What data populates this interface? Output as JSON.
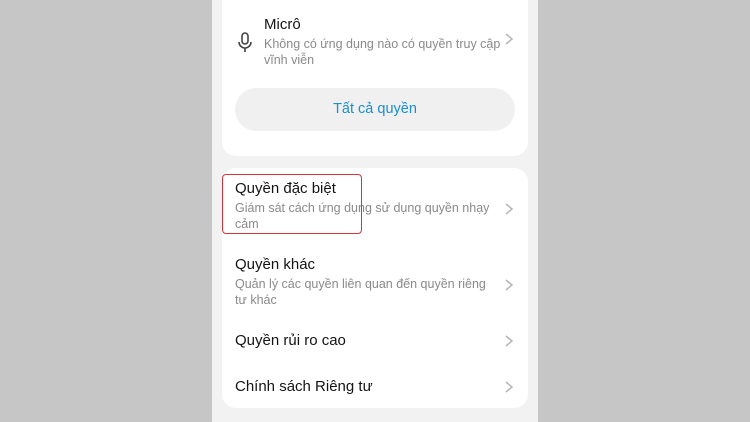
{
  "permissions": {
    "mic": {
      "title": "Micrô",
      "desc": "Không có ứng dụng nào có quyền truy cập vĩnh viễn",
      "icon": "microphone-icon"
    },
    "all_button": "Tất cả quyền",
    "items": [
      {
        "title": "Quyền đặc biệt",
        "desc": "Giám sát cách ứng dụng sử dụng quyền nhạy cảm"
      },
      {
        "title": "Quyền khác",
        "desc": "Quản lý các quyền liên quan đến quyền riêng tư khác"
      },
      {
        "title": "Quyền rủi ro cao"
      },
      {
        "title": "Chính sách Riêng tư"
      }
    ]
  },
  "colors": {
    "accent": "#1a8fcf",
    "highlight": "#d0343a",
    "backdrop": "#c6c6c6"
  }
}
